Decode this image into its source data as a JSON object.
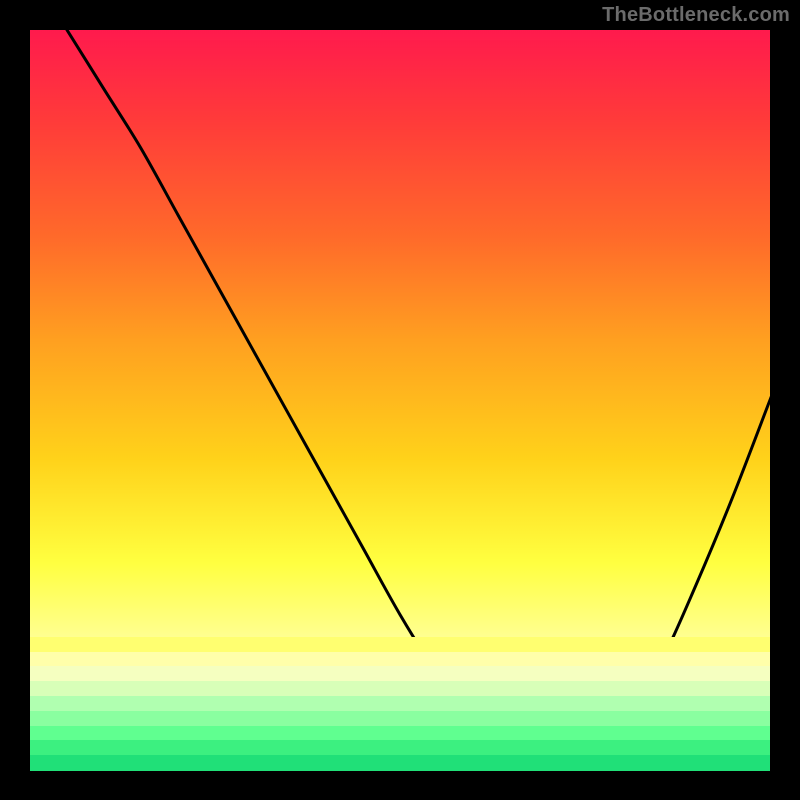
{
  "attribution": "TheBottleneck.com",
  "chart_data": {
    "type": "line",
    "title": "",
    "xlabel": "",
    "ylabel": "",
    "xlim": [
      0,
      100
    ],
    "ylim": [
      0,
      100
    ],
    "grid": false,
    "legend": false,
    "series": [
      {
        "name": "curve",
        "x": [
          5,
          10,
          15,
          20,
          25,
          30,
          35,
          40,
          45,
          50,
          55,
          58,
          60,
          62,
          65,
          68,
          72,
          75,
          80,
          85,
          90,
          95,
          100
        ],
        "values": [
          100,
          92,
          84,
          75,
          66,
          57,
          48,
          39,
          30,
          21,
          13,
          9,
          6,
          4,
          2,
          1,
          1,
          2,
          6,
          14,
          25,
          37,
          50
        ]
      }
    ],
    "markers": {
      "name": "highlight-dots",
      "x": [
        55,
        57,
        59,
        61,
        63,
        65,
        67,
        69,
        71,
        73,
        75,
        77,
        79,
        81,
        83,
        85
      ],
      "values": [
        13.5,
        10.5,
        8,
        6,
        4.5,
        3.2,
        2.2,
        1.5,
        1.2,
        1.3,
        2,
        3.2,
        5,
        7.5,
        10.5,
        14
      ]
    },
    "gradient_bands": [
      {
        "y": 82,
        "height": 2.2,
        "color": "#ffff70"
      },
      {
        "y": 84,
        "height": 2.2,
        "color": "#ffffaa"
      },
      {
        "y": 86,
        "height": 2.2,
        "color": "#f5ffc0"
      },
      {
        "y": 88,
        "height": 2.2,
        "color": "#d8ffb8"
      },
      {
        "y": 90,
        "height": 2.2,
        "color": "#b0ffb0"
      },
      {
        "y": 92,
        "height": 2.2,
        "color": "#8affa0"
      },
      {
        "y": 94,
        "height": 2.2,
        "color": "#60ff90"
      },
      {
        "y": 96,
        "height": 2.2,
        "color": "#3cf080"
      },
      {
        "y": 98,
        "height": 2.2,
        "color": "#20e078"
      }
    ]
  }
}
